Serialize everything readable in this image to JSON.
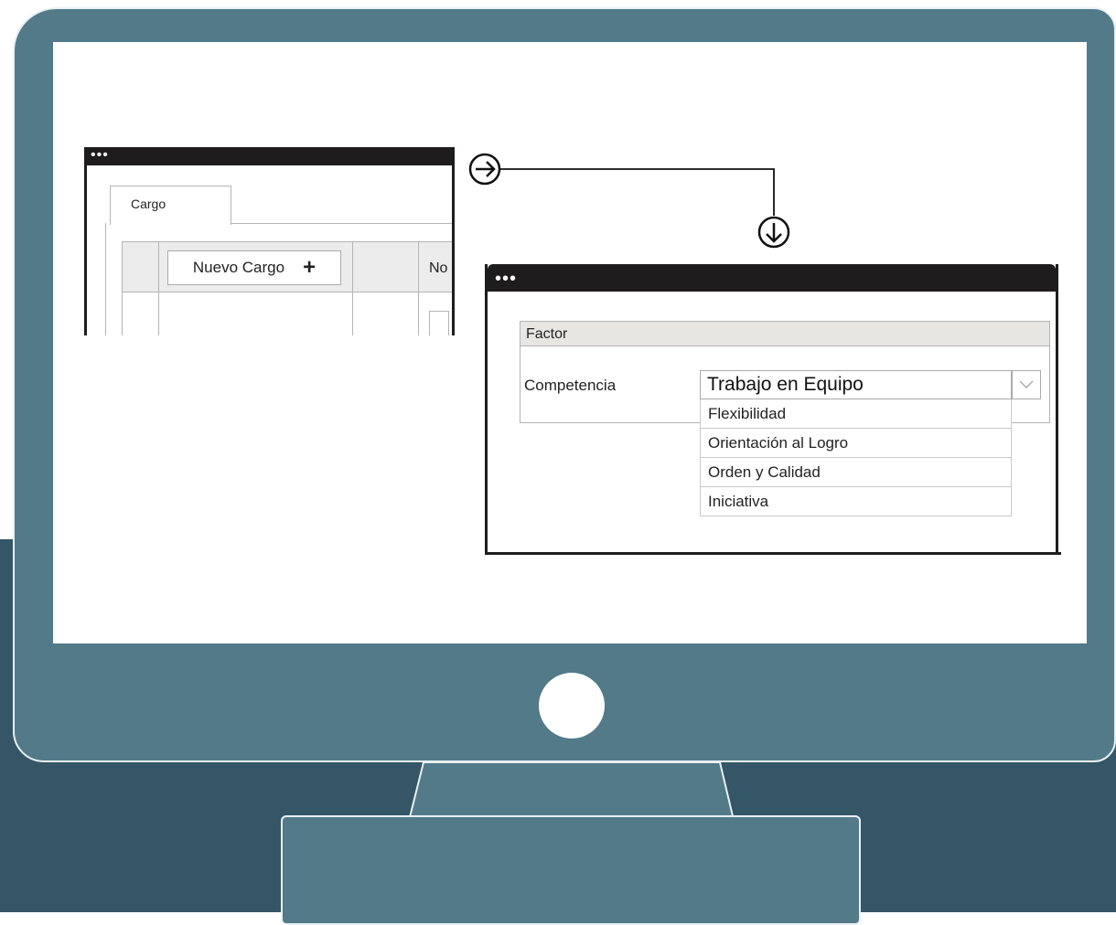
{
  "window1": {
    "tab_label": "Cargo",
    "button_label": "Nuevo Cargo",
    "button_icon": "plus-icon",
    "column_partial": "No"
  },
  "window2": {
    "panel_title": "Factor",
    "field_label": "Competencia",
    "selected_value": "Trabajo en Equipo",
    "options": [
      "Flexibilidad",
      "Orientación al Logro",
      "Orden y Calidad",
      "Iniciativa"
    ]
  },
  "icons": {
    "arrow_right": "circle-arrow-right-icon",
    "arrow_down": "circle-arrow-down-icon",
    "dropdown": "chevron-down-icon"
  },
  "colors": {
    "monitor": "#527a89",
    "background_dark": "#345667",
    "titlebar": "#1f1c1d"
  }
}
